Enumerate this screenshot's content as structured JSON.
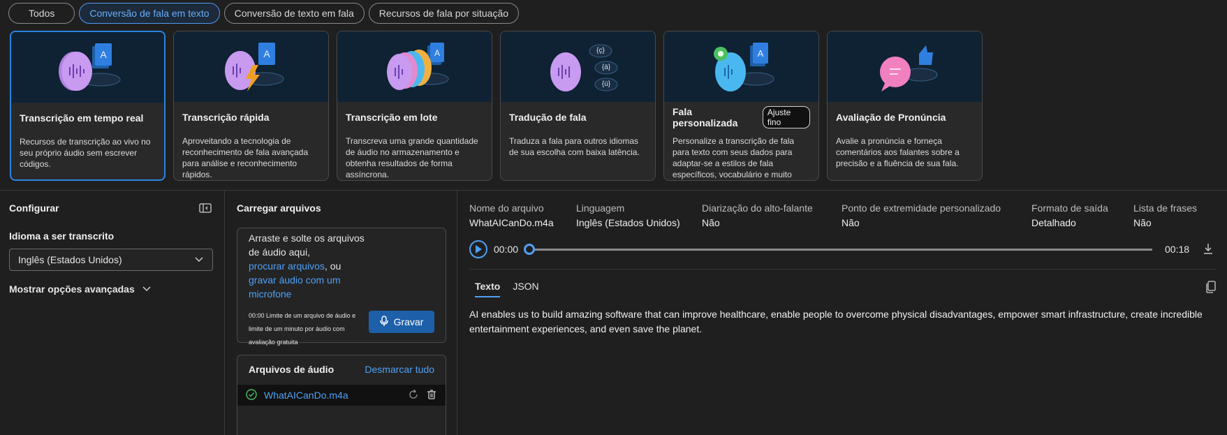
{
  "pills": [
    "Todos",
    "Conversão de fala em texto",
    "Conversão de texto em fala",
    "Recursos de fala por situação"
  ],
  "cards": [
    {
      "title": "Transcrição em tempo real",
      "desc": "Recursos de transcrição ao vivo no seu próprio áudio sem escrever códigos.",
      "badge": ""
    },
    {
      "title": "Transcrição rápida",
      "desc": "Aproveitando a tecnologia de reconhecimento de fala avançada para análise e reconhecimento rápidos.",
      "badge": ""
    },
    {
      "title": "Transcrição em lote",
      "desc": "Transcreva uma grande quantidade de áudio no armazenamento e obtenha resultados de forma assíncrona.",
      "badge": ""
    },
    {
      "title": "Tradução de fala",
      "desc": "Traduza a fala para outros idiomas de sua escolha com baixa latência.",
      "badge": ""
    },
    {
      "title": "Fala personalizada",
      "desc": "Personalize a transcrição de fala para texto com seus dados para adaptar-se a estilos de fala específicos, vocabulário e muito mais.",
      "badge": "Ajuste fino"
    },
    {
      "title": "Avaliação de Pronúncia",
      "desc": "Avalie a pronúncia e forneça comentários aos falantes sobre a precisão e a fluência de sua fala.",
      "badge": ""
    }
  ],
  "configure": {
    "title": "Configurar",
    "lang_label": "Idioma a ser transcrito",
    "lang_value": "Inglês (Estados Unidos)",
    "advanced": "Mostrar opções avançadas"
  },
  "upload": {
    "title": "Carregar arquivos",
    "drop_text": "Arraste e solte os arquivos de áudio aqui,",
    "browse": "procurar arquivos",
    "or": ", ou",
    "record_link": "gravar áudio com um microfone",
    "limit": "00:00 Limite de um arquivo de áudio e limite de um minuto por áudio com avaliação gratuita",
    "record_btn": "Gravar",
    "files_title": "Arquivos de áudio",
    "unselect": "Desmarcar tudo",
    "file": "WhatAICanDo.m4a"
  },
  "result": {
    "meta": [
      {
        "label": "Nome do arquivo",
        "value": "WhatAICanDo.m4a"
      },
      {
        "label": "Linguagem",
        "value": "Inglês (Estados Unidos)"
      },
      {
        "label": "Diarização do alto-falante",
        "value": "Não"
      },
      {
        "label": "Ponto de extremidade personalizado",
        "value": "Não"
      },
      {
        "label": "Formato de saída",
        "value": "Detalhado"
      },
      {
        "label": "Lista de frases",
        "value": "Não"
      }
    ],
    "time_start": "00:00",
    "time_end": "00:18",
    "tabs": [
      "Texto",
      "JSON"
    ],
    "transcript": "AI enables us to build amazing software that can improve healthcare, enable people to overcome physical disadvantages, empower smart infrastructure, create incredible entertainment experiences, and even save the planet."
  },
  "colors": {
    "accent": "#4fa0f5",
    "primary_button": "#1d5fa8",
    "card_art_bg": "#0e2233"
  }
}
